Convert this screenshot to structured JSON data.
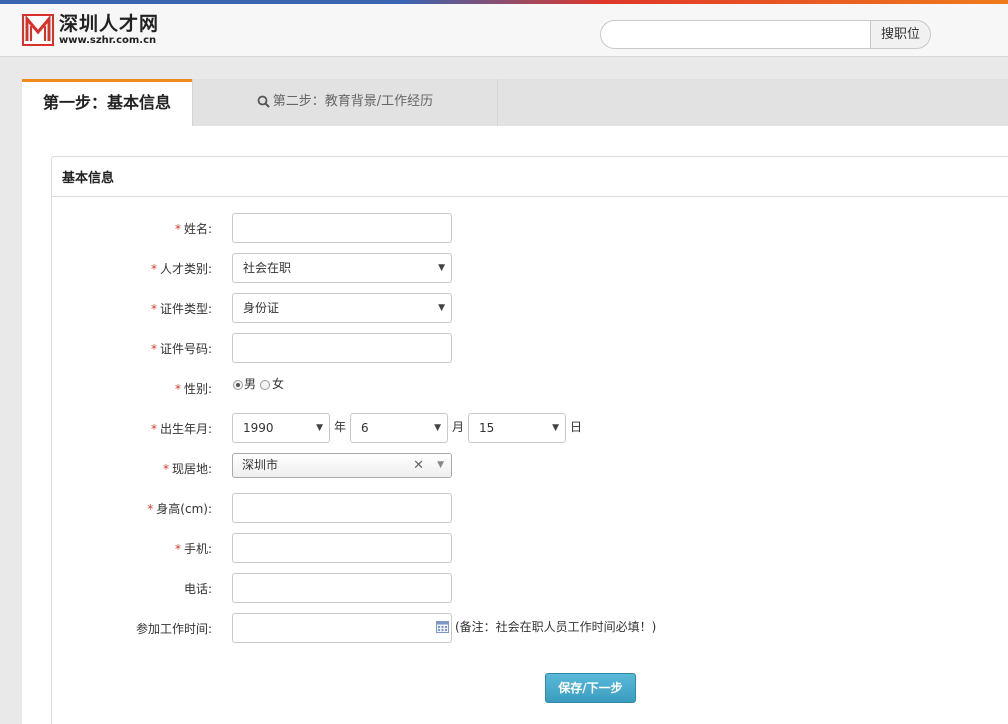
{
  "header": {
    "logo_title": "深圳人才网",
    "logo_url": "www.szhr.com.cn",
    "search_placeholder": "",
    "search_button": "搜职位",
    "accent_colors": {
      "blue": "#3a63b0",
      "red": "#e0372a",
      "orange": "#f07b1a"
    }
  },
  "tabs": [
    {
      "label": "第一步：基本信息",
      "active": true
    },
    {
      "label": "第二步：教育背景/工作经历",
      "active": false,
      "icon": "search-icon"
    }
  ],
  "panel": {
    "title": "基本信息"
  },
  "form": {
    "name_label": "姓名:",
    "category_label": "人才类别:",
    "category_value": "社会在职",
    "idtype_label": "证件类型:",
    "idtype_value": "身份证",
    "idnum_label": "证件号码:",
    "gender_label": "性别:",
    "gender_male": "男",
    "gender_female": "女",
    "gender_selected": "男",
    "birth_label": "出生年月:",
    "birth_year": "1990",
    "birth_year_unit": "年",
    "birth_month": "6",
    "birth_month_unit": "月",
    "birth_day": "15",
    "birth_day_unit": "日",
    "city_label": "现居地:",
    "city_value": "深圳市",
    "height_label": "身高(cm):",
    "mobile_label": "手机:",
    "phone_label": "电话:",
    "workstart_label": "参加工作时间:",
    "workstart_note": "(备注：社会在职人员工作时间必填！)",
    "required_mark": "*",
    "submit_label": "保存/下一步"
  }
}
